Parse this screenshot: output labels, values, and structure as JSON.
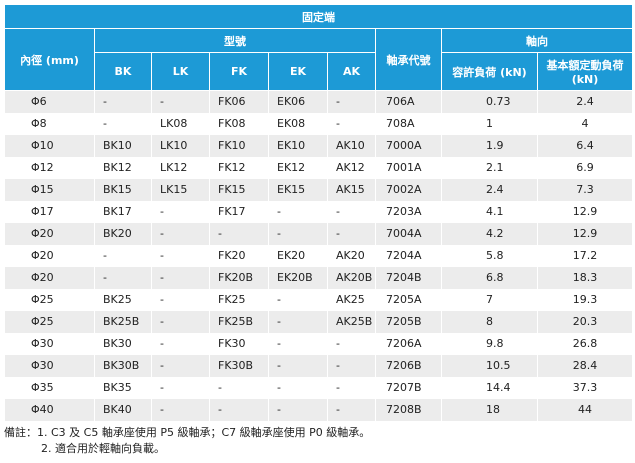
{
  "table": {
    "title": "固定端",
    "header": {
      "bore": "內徑 (mm)",
      "model_group": "型號",
      "bearing_code": "軸承代號",
      "axial_group": "軸向",
      "models": [
        "BK",
        "LK",
        "FK",
        "EK",
        "AK"
      ],
      "allowable_load": "容許負荷 (kN)",
      "rated_load": "基本額定動負荷 (kN)"
    },
    "rows": [
      {
        "bore": "Φ6",
        "bk": "-",
        "lk": "-",
        "fk": "FK06",
        "ek": "EK06",
        "ak": "-",
        "bearing": "706A",
        "load": "0.73",
        "rated": "2.4"
      },
      {
        "bore": "Φ8",
        "bk": "-",
        "lk": "LK08",
        "fk": "FK08",
        "ek": "EK08",
        "ak": "-",
        "bearing": "708A",
        "load": "1",
        "rated": "4"
      },
      {
        "bore": "Φ10",
        "bk": "BK10",
        "lk": "LK10",
        "fk": "FK10",
        "ek": "EK10",
        "ak": "AK10",
        "bearing": "7000A",
        "load": "1.9",
        "rated": "6.4"
      },
      {
        "bore": "Φ12",
        "bk": "BK12",
        "lk": "LK12",
        "fk": "FK12",
        "ek": "EK12",
        "ak": "AK12",
        "bearing": "7001A",
        "load": "2.1",
        "rated": "6.9"
      },
      {
        "bore": "Φ15",
        "bk": "BK15",
        "lk": "LK15",
        "fk": "FK15",
        "ek": "EK15",
        "ak": "AK15",
        "bearing": "7002A",
        "load": "2.4",
        "rated": "7.3"
      },
      {
        "bore": "Φ17",
        "bk": "BK17",
        "lk": "-",
        "fk": "FK17",
        "ek": "-",
        "ak": "-",
        "bearing": "7203A",
        "load": "4.1",
        "rated": "12.9"
      },
      {
        "bore": "Φ20",
        "bk": "BK20",
        "lk": "-",
        "fk": "-",
        "ek": "-",
        "ak": "-",
        "bearing": "7004A",
        "load": "4.2",
        "rated": "12.9"
      },
      {
        "bore": "Φ20",
        "bk": "-",
        "lk": "-",
        "fk": "FK20",
        "ek": "EK20",
        "ak": "AK20",
        "bearing": "7204A",
        "load": "5.8",
        "rated": "17.2"
      },
      {
        "bore": "Φ20",
        "bk": "-",
        "lk": "-",
        "fk": "FK20B",
        "ek": "EK20B",
        "ak": "AK20B",
        "bearing": "7204B",
        "load": "6.8",
        "rated": "18.3"
      },
      {
        "bore": "Φ25",
        "bk": "BK25",
        "lk": "-",
        "fk": "FK25",
        "ek": "-",
        "ak": "AK25",
        "bearing": "7205A",
        "load": "7",
        "rated": "19.3"
      },
      {
        "bore": "Φ25",
        "bk": "BK25B",
        "lk": "-",
        "fk": "FK25B",
        "ek": "-",
        "ak": "AK25B",
        "bearing": "7205B",
        "load": "8",
        "rated": "20.3"
      },
      {
        "bore": "Φ30",
        "bk": "BK30",
        "lk": "-",
        "fk": "FK30",
        "ek": "-",
        "ak": "-",
        "bearing": "7206A",
        "load": "9.8",
        "rated": "26.8"
      },
      {
        "bore": "Φ30",
        "bk": "BK30B",
        "lk": "-",
        "fk": "FK30B",
        "ek": "-",
        "ak": "-",
        "bearing": "7206B",
        "load": "10.5",
        "rated": "28.4"
      },
      {
        "bore": "Φ35",
        "bk": "BK35",
        "lk": "-",
        "fk": "-",
        "ek": "-",
        "ak": "-",
        "bearing": "7207B",
        "load": "14.4",
        "rated": "37.3"
      },
      {
        "bore": "Φ40",
        "bk": "BK40",
        "lk": "-",
        "fk": "-",
        "ek": "-",
        "ak": "-",
        "bearing": "7208B",
        "load": "18",
        "rated": "44"
      }
    ]
  },
  "notes": {
    "line1": "備註：1. C3 及 C5 軸承座使用 P5 級軸承；C7 級軸承座使用 P0 級軸承。",
    "line2": "2. 適合用於輕軸向負載。"
  },
  "colors": {
    "header_bg": "#1d9ad6",
    "header_text": "#ffffff",
    "row_stripe": "#ececec"
  }
}
